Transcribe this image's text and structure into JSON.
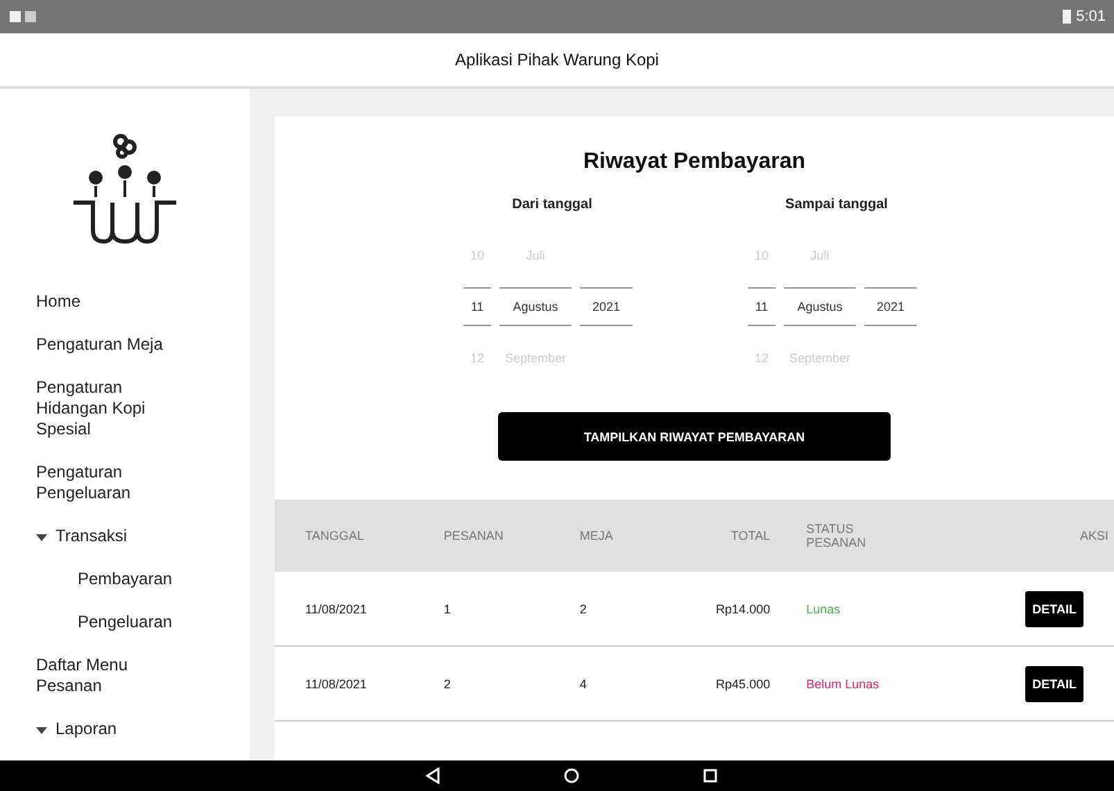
{
  "status_bar": {
    "time": "5:01"
  },
  "app_bar": {
    "title": "Aplikasi Pihak Warung Kopi"
  },
  "sidebar": {
    "items": [
      {
        "label": "Home",
        "kind": "item"
      },
      {
        "label": "Pengaturan Meja",
        "kind": "item"
      },
      {
        "label": "Pengaturan Hidangan Kopi Spesial",
        "kind": "item"
      },
      {
        "label": "Pengaturan Pengeluaran",
        "kind": "item"
      },
      {
        "label": "Transaksi",
        "kind": "group",
        "expanded": true,
        "children": [
          {
            "label": "Pembayaran"
          },
          {
            "label": "Pengeluaran"
          }
        ]
      },
      {
        "label": "Daftar Menu Pesanan",
        "kind": "item"
      },
      {
        "label": "Laporan",
        "kind": "group",
        "expanded": true
      }
    ]
  },
  "page": {
    "title": "Riwayat Pembayaran",
    "date_pickers": [
      {
        "label": "Dari tanggal",
        "prev": [
          "10",
          "Juli"
        ],
        "current": [
          "11",
          "Agustus",
          "2021"
        ],
        "next": [
          "12",
          "September"
        ]
      },
      {
        "label": "Sampai tanggal",
        "prev": [
          "10",
          "Juli"
        ],
        "current": [
          "11",
          "Agustus",
          "2021"
        ],
        "next": [
          "12",
          "September"
        ]
      }
    ],
    "show_button": "TAMPILKAN RIWAYAT PEMBAYARAN",
    "table": {
      "columns": [
        "TANGGAL",
        "PESANAN",
        "MEJA",
        "TOTAL",
        "STATUS PESANAN",
        "AKSI"
      ],
      "rows": [
        {
          "date": "11/08/2021",
          "order": "1",
          "table": "2",
          "total": "Rp14.000",
          "status": "Lunas",
          "color": "#4caf50",
          "action": "DETAIL"
        },
        {
          "date": "11/08/2021",
          "order": "2",
          "table": "4",
          "total": "Rp45.000",
          "status": "Belum Lunas",
          "color": "#e91e63",
          "action": "DETAIL"
        }
      ]
    }
  }
}
